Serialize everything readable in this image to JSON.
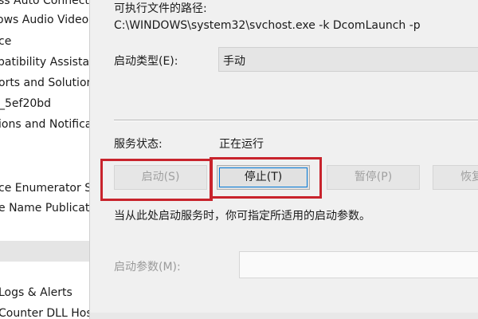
{
  "service_list": {
    "items": [
      "ss Auto Connectio",
      "ows Audio Video I",
      "ce",
      "patibility Assistan",
      "orts and Solutions",
      "_5ef20bd",
      "ions and Notificat",
      "ce Enumerator Se",
      "e Name Publicatio",
      "Logs & Alerts",
      "Counter DLL Host"
    ]
  },
  "dialog": {
    "executable_path_label": "可执行文件的路径:",
    "executable_path_value": "C:\\WINDOWS\\system32\\svchost.exe -k DcomLaunch -p",
    "startup_type_label": "启动类型(E):",
    "startup_type_value": "手动",
    "service_status_label": "服务状态:",
    "service_status_value": "正在运行",
    "buttons": {
      "start": "启动(S)",
      "stop": "停止(T)",
      "pause": "暂停(P)",
      "resume": "恢复"
    },
    "hint_text": "当从此处启动服务时，你可指定所适用的启动参数。",
    "start_params_label": "启动参数(M):",
    "start_params_value": ""
  },
  "colors": {
    "highlight_box": "#c8232c",
    "dialog_bg": "#f0f0f0",
    "focus_border": "#0078d7"
  }
}
